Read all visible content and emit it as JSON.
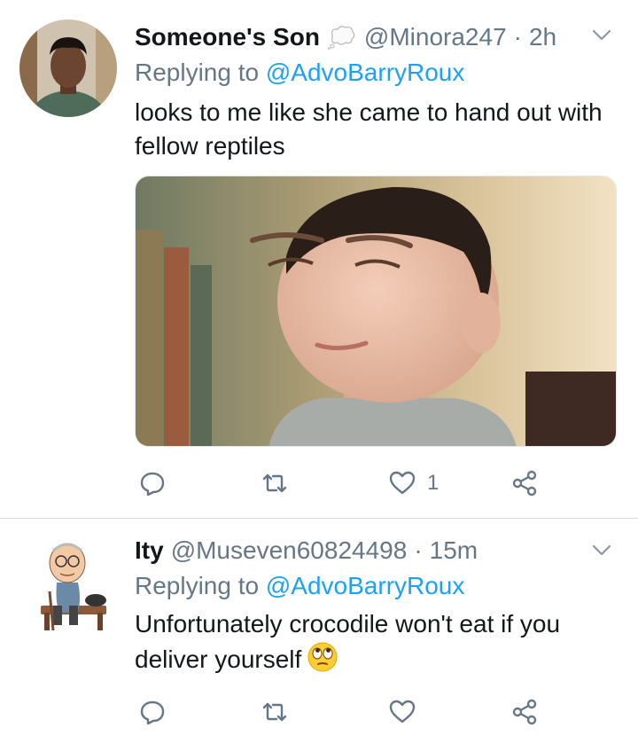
{
  "tweets": [
    {
      "display_name": "Someone's Son",
      "handle": "@Minora247",
      "separator": "·",
      "time": "2h",
      "replying_prefix": "Replying to",
      "replying_to": "@AdvoBarryRoux",
      "text": "looks to me like she came to hand out with fellow reptiles",
      "like_count": "1",
      "icons": [
        "reply-icon",
        "retweet-icon",
        "like-icon",
        "share-icon"
      ]
    },
    {
      "display_name": "Ity",
      "handle": "@Museven60824498",
      "separator": "·",
      "time": "15m",
      "replying_prefix": "Replying to",
      "replying_to": "@AdvoBarryRoux",
      "text": "Unfortunately crocodile won't eat if you deliver yourself",
      "emoji": "face-with-rolling-eyes",
      "icons": [
        "reply-icon",
        "retweet-icon",
        "like-icon",
        "share-icon"
      ]
    }
  ],
  "colors": {
    "text": "#14171a",
    "secondary": "#657786",
    "link": "#1da1f2",
    "divider": "#d4d9de"
  }
}
